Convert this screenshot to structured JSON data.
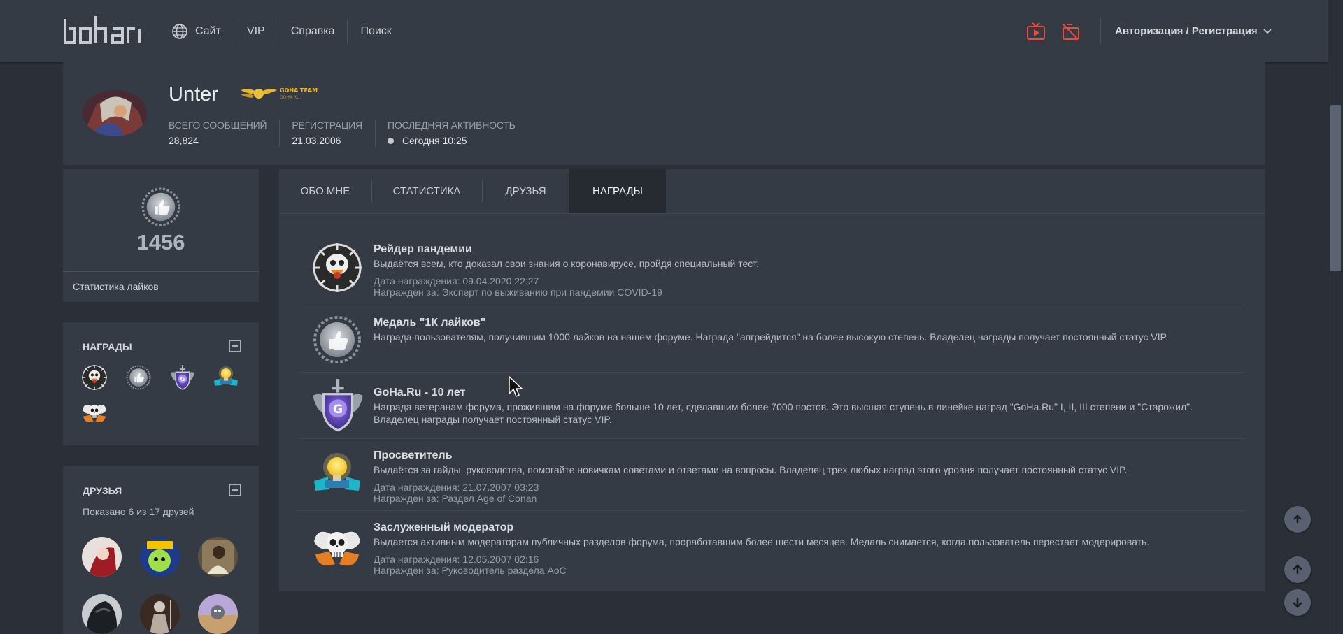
{
  "header": {
    "logo_text": "goha.ru",
    "nav": [
      {
        "label": "Сайт",
        "icon": "globe-icon"
      },
      {
        "label": "VIP"
      },
      {
        "label": "Справка"
      },
      {
        "label": "Поиск"
      }
    ],
    "icons": [
      "tv-icon",
      "stream-off-icon"
    ],
    "auth_label": "Авторизация / Регистрация",
    "accent": "#e74c3c"
  },
  "profile": {
    "username": "Unter",
    "badge_text": "GOHA TEAM",
    "badge_sub": "GOHA.RU",
    "stats": [
      {
        "label": "ВСЕГО СООБЩЕНИЙ",
        "value": "28,824"
      },
      {
        "label": "РЕГИСТРАЦИЯ",
        "value": "21.03.2006"
      },
      {
        "label": "ПОСЛЕДНЯЯ АКТИВНОСТЬ",
        "value": "Сегодня 10:25"
      }
    ]
  },
  "likes_widget": {
    "count": "1456",
    "link": "Статистика лайков"
  },
  "awards_widget": {
    "title": "НАГРАДЫ",
    "icons": [
      "skull-gasmask-icon",
      "thumbs-up-medal-icon",
      "shield-g-icon",
      "lightbulb-icon",
      "skull-wings-icon"
    ]
  },
  "friends_widget": {
    "title": "ДРУЗЬЯ",
    "subtitle": "Показано 6 из 17 друзей"
  },
  "tabs": [
    {
      "label": "ОБО МНЕ",
      "active": false
    },
    {
      "label": "СТАТИСТИКА",
      "active": false
    },
    {
      "label": "ДРУЗЬЯ",
      "active": false
    },
    {
      "label": "НАГРАДЫ",
      "active": true
    }
  ],
  "awards": [
    {
      "title": "Рейдер пандемии",
      "desc": "Выдаётся всем, кто доказал свои знания о коронавирусе, пройдя специальный тест.",
      "date": "Дата награждения: 09.04.2020 22:27",
      "reason": "Награжден за: Эксперт по выживанию при пандемии COVID-19",
      "icon": "skull-gasmask-icon"
    },
    {
      "title": "Медаль \"1К лайков\"",
      "desc": "Награда пользователям, получившим 1000 лайков на нашем форуме. Награда \"апгрейдится\" на более высокую степень. Владелец награды получает постоянный статус VIP.",
      "date": "",
      "reason": "",
      "icon": "thumbs-up-medal-icon"
    },
    {
      "title": "GoHa.Ru - 10 лет",
      "desc": "Награда ветеранам форума, прожившим на форуме больше 10 лет, сделавшим более 7000 постов. Это высшая ступень в линейке наград \"GoHa.Ru\" I, II, III степени и \"Старожил\". Владелец награды получает постоянный статус VIP.",
      "date": "",
      "reason": "",
      "icon": "shield-g-icon"
    },
    {
      "title": "Просветитель",
      "desc": "Выдаётся за гайды, руководства, помогайте новичкам советами и ответами на вопросы. Владелец трех любых наград этого уровня получает постоянный статус VIP.",
      "date": "Дата награждения: 21.07.2007 03:23",
      "reason": "Награжден за: Раздел Age of Conan",
      "icon": "lightbulb-icon"
    },
    {
      "title": "Заслуженный модератор",
      "desc": "Выдается активным модераторам публичных разделов форума, проработавшим более шести месяцев. Медаль снимается, когда пользователь перестает модерировать.",
      "date": "Дата награждения: 12.05.2007 02:16",
      "reason": "Награжден за: Руководитель раздела AoC",
      "icon": "skull-wings-icon"
    }
  ]
}
